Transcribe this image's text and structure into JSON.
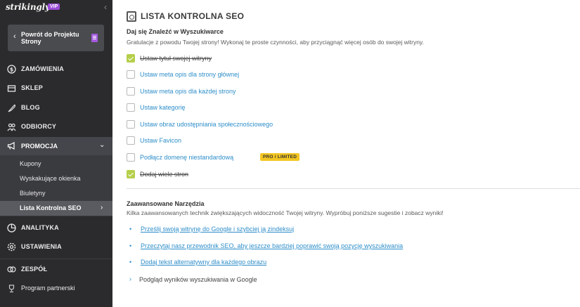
{
  "brand": {
    "logo": "strikingly",
    "vip": "VIP"
  },
  "sidebar": {
    "collapse_icon": "chevron-left-icon",
    "back_label": "Powrót do Projektu Strony",
    "items": [
      {
        "label": "ZAMÓWIENIA",
        "icon": "dollar-icon"
      },
      {
        "label": "SKLEP",
        "icon": "store-icon"
      },
      {
        "label": "BLOG",
        "icon": "feather-icon"
      },
      {
        "label": "ODBIORCY",
        "icon": "people-icon"
      }
    ],
    "promo": {
      "label": "PROMOCJA",
      "icon": "megaphone-icon",
      "sub": [
        "Kupony",
        "Wyskakujące okienka",
        "Biuletyny",
        "Lista Kontrolna SEO"
      ]
    },
    "items2": [
      {
        "label": "ANALITYKA",
        "icon": "chart-icon"
      },
      {
        "label": "USTAWIENIA",
        "icon": "gear-icon"
      },
      {
        "label": "ZESPÓŁ",
        "icon": "team-icon"
      },
      {
        "label": "Program partnerski",
        "icon": "trophy-icon"
      }
    ]
  },
  "main": {
    "title": "LISTA KONTROLNA SEO",
    "section1": {
      "title": "Daj się Znaleźć w Wyszukiwarce",
      "desc": "Gratulacje z powodu Twojej strony! Wykonaj te proste czynności, aby przyciągnąć więcej osób do swojej witryny.",
      "tasks": [
        {
          "label": "Ustaw tytuł swojej witryny",
          "done": true
        },
        {
          "label": "Ustaw meta opis dla strony głównej",
          "done": false
        },
        {
          "label": "Ustaw meta opis dla każdej strony",
          "done": false
        },
        {
          "label": "Ustaw kategorię",
          "done": false
        },
        {
          "label": "Ustaw obraz udostępniania społecznościowego",
          "done": false
        },
        {
          "label": "Ustaw Favicon",
          "done": false
        },
        {
          "label": "Podłącz domenę niestandardową",
          "done": false,
          "badge": "PRO / LIMITED"
        },
        {
          "label": "Dodaj wiele stron",
          "done": true
        }
      ]
    },
    "section2": {
      "title": "Zaawansowane Narzędzia",
      "desc": "Kilka zaawansowanych technik zwiększających widoczność Twojej witryny. Wypróbuj poniższe sugestie i zobacz wyniki!",
      "links": [
        "Prześlij swoją witrynę do Google i szybciej ją zindeksuj",
        "Przeczytaj nasz przewodnik SEO, aby jeszcze bardziej poprawić swoją pozycję wyszukiwania",
        "Dodaj tekst alternatywny dla każdego obrazu"
      ],
      "preview": "Podgląd wyników wyszukiwania w Google"
    }
  },
  "colors": {
    "accent": "#2e8ec9",
    "check": "#b5cf4a",
    "vip": "#9b4dd8",
    "badge": "#f3c623"
  }
}
